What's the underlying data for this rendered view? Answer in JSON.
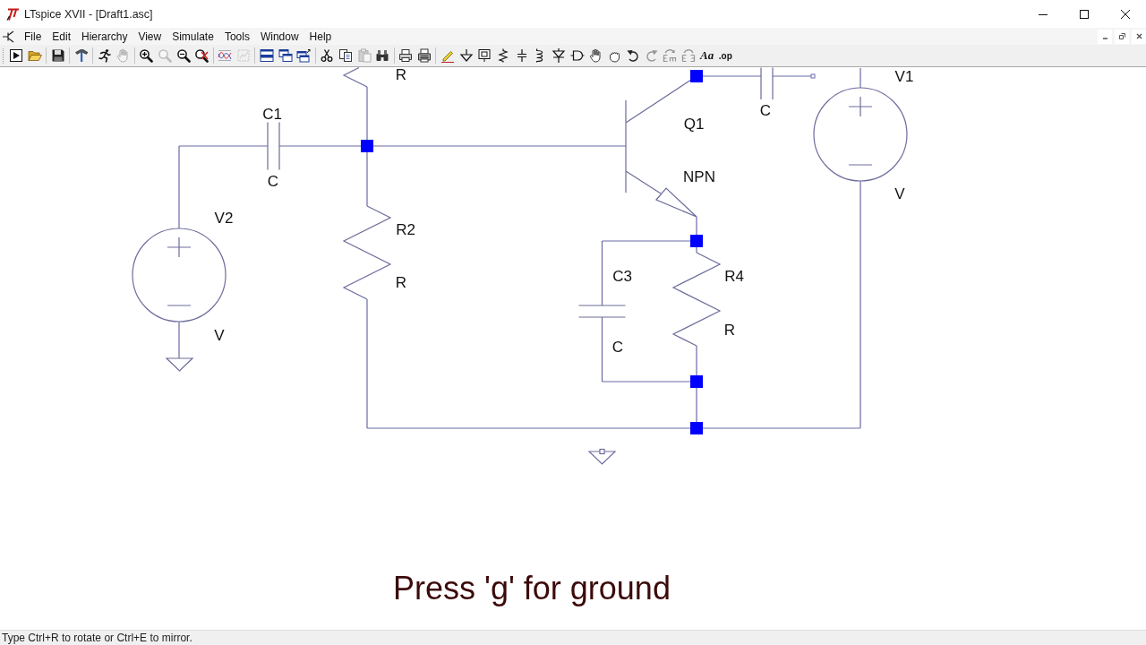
{
  "window": {
    "title": "LTspice XVII - [Draft1.asc]"
  },
  "menu_bar": {
    "items": [
      "File",
      "Edit",
      "Hierarchy",
      "View",
      "Simulate",
      "Tools",
      "Window",
      "Help"
    ]
  },
  "toolbar": {
    "groups": [
      {
        "items": [
          {
            "kind": "run",
            "disabled": false
          },
          {
            "kind": "open",
            "disabled": false
          }
        ]
      },
      {
        "items": [
          {
            "kind": "save",
            "disabled": false
          }
        ]
      },
      {
        "items": [
          {
            "kind": "settings",
            "disabled": false
          }
        ]
      },
      {
        "items": [
          {
            "kind": "halt",
            "disabled": false
          },
          {
            "kind": "pan",
            "disabled": true
          }
        ]
      },
      {
        "items": [
          {
            "kind": "zoom_in",
            "disabled": false
          },
          {
            "kind": "zoom_fit",
            "disabled": true
          },
          {
            "kind": "zoom_out",
            "disabled": false
          },
          {
            "kind": "zoom_cancel",
            "disabled": false
          }
        ]
      },
      {
        "items": [
          {
            "kind": "autorange",
            "disabled": false
          },
          {
            "kind": "plot",
            "disabled": true
          }
        ]
      },
      {
        "items": [
          {
            "kind": "tile",
            "disabled": false
          },
          {
            "kind": "cascade",
            "disabled": false
          },
          {
            "kind": "arrange",
            "disabled": false
          }
        ]
      },
      {
        "items": [
          {
            "kind": "cut",
            "disabled": false
          },
          {
            "kind": "copy",
            "disabled": false
          },
          {
            "kind": "paste",
            "disabled": true
          },
          {
            "kind": "find",
            "disabled": false
          }
        ]
      },
      {
        "items": [
          {
            "kind": "print",
            "disabled": false
          },
          {
            "kind": "print_setup",
            "disabled": false
          }
        ]
      },
      {
        "items": [
          {
            "kind": "wire",
            "disabled": false
          },
          {
            "kind": "ground",
            "disabled": false
          },
          {
            "kind": "label",
            "disabled": false
          },
          {
            "kind": "resistor",
            "disabled": false
          },
          {
            "kind": "capacitor",
            "disabled": false
          },
          {
            "kind": "inductor",
            "disabled": false
          },
          {
            "kind": "diode",
            "disabled": false
          },
          {
            "kind": "component",
            "disabled": false
          },
          {
            "kind": "move",
            "disabled": false
          },
          {
            "kind": "drag",
            "disabled": false
          },
          {
            "kind": "undo",
            "disabled": false
          },
          {
            "kind": "redo",
            "disabled": true
          },
          {
            "kind": "rotate",
            "disabled": true
          },
          {
            "kind": "mirror",
            "disabled": true
          },
          {
            "kind": "text",
            "label": "Aa",
            "disabled": false
          },
          {
            "kind": "directive",
            "label": ".op",
            "disabled": false
          }
        ]
      }
    ]
  },
  "schematic": {
    "components": [
      {
        "kind": "resistor",
        "value": "R"
      },
      {
        "kind": "capacitor",
        "name": "C1",
        "value": "C"
      },
      {
        "kind": "npn",
        "name": "Q1",
        "value": "NPN"
      },
      {
        "kind": "capacitor",
        "value": "C"
      },
      {
        "kind": "voltage_source",
        "name": "V1",
        "value": "V"
      },
      {
        "kind": "voltage_source",
        "name": "V2",
        "value": "V"
      },
      {
        "kind": "resistor",
        "name": "R2",
        "value": "R"
      },
      {
        "kind": "capacitor",
        "name": "C3",
        "value": "C"
      },
      {
        "kind": "resistor",
        "name": "R4",
        "value": "R"
      },
      {
        "kind": "ground"
      },
      {
        "kind": "ground"
      }
    ]
  },
  "caption": "Press 'g' for ground",
  "status_bar": {
    "text": "Type Ctrl+R to rotate or Ctrl+E to mirror."
  }
}
